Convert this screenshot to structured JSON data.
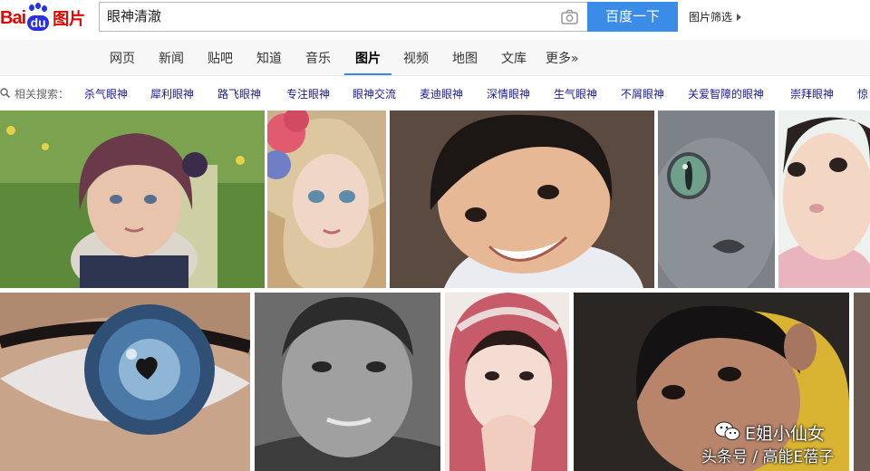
{
  "header": {
    "logo": {
      "bai": "Bai",
      "du": "du",
      "pic": "图片"
    },
    "search": {
      "value": "眼神清澈"
    },
    "search_button": "百度一下",
    "filter_link": "图片筛选"
  },
  "nav": {
    "items": [
      {
        "label": "网页"
      },
      {
        "label": "新闻"
      },
      {
        "label": "贴吧"
      },
      {
        "label": "知道"
      },
      {
        "label": "音乐"
      },
      {
        "label": "图片",
        "active": true
      },
      {
        "label": "视频"
      },
      {
        "label": "地图"
      },
      {
        "label": "文库"
      },
      {
        "label": "更多»"
      }
    ]
  },
  "related": {
    "label": "相关搜索：",
    "items": [
      "杀气眼神",
      "犀利眼神",
      "路飞眼神",
      "专注眼神",
      "眼神交流",
      "麦迪眼神",
      "深情眼神",
      "生气眼神",
      "不屑眼神",
      "关爱智障的眼神",
      "崇拜眼神",
      "惊"
    ]
  },
  "images": [
    {
      "name": "girl-with-flower-hairband"
    },
    {
      "name": "doll-girl-with-flowers"
    },
    {
      "name": "smiling-boy"
    },
    {
      "name": "gray-cat-green-eye"
    },
    {
      "name": "toddler-girl"
    },
    {
      "name": "blue-eye-closeup"
    },
    {
      "name": "boy-black-and-white"
    },
    {
      "name": "girl-knit-hat"
    },
    {
      "name": "boy-yellow-hood"
    }
  ],
  "watermark": {
    "line1": "E姐小仙女",
    "line2": "头条号 / 高能E蓓子"
  },
  "colors": {
    "brand_red": "#e10601",
    "brand_blue": "#2932e1",
    "button_blue": "#3a8ce6",
    "link_blue": "#1a1a8c"
  }
}
